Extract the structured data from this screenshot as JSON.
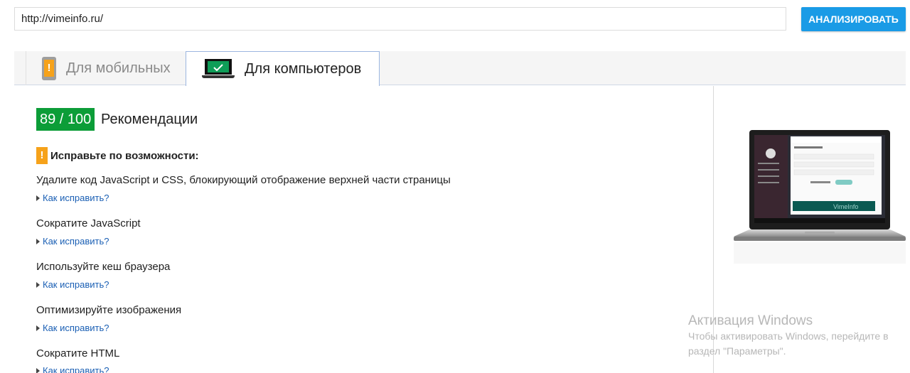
{
  "url_bar": {
    "value": "http://vimeinfo.ru/",
    "button_label": "АНАЛИЗИРОВАТЬ"
  },
  "tabs": [
    {
      "label": "Для мобильных",
      "icon": "phone-warning-icon",
      "active": false
    },
    {
      "label": "Для компьютеров",
      "icon": "laptop-check-icon",
      "active": true
    }
  ],
  "score": {
    "value": "89 / 100",
    "label": "Рекомендации",
    "color": "#0c9d38"
  },
  "section": {
    "heading": "Исправьте по возможности:",
    "icon": "warning-icon",
    "color": "#f6a21a"
  },
  "rules": [
    {
      "title": "Удалите код JavaScript и CSS, блокирующий отображение верхней части страницы",
      "link": "Как исправить?"
    },
    {
      "title": "Сократите JavaScript",
      "link": "Как исправить?"
    },
    {
      "title": "Используйте кеш браузера",
      "link": "Как исправить?"
    },
    {
      "title": "Оптимизируйте изображения",
      "link": "Как исправить?"
    },
    {
      "title": "Сократите HTML",
      "link": "Как исправить?"
    }
  ],
  "preview": {
    "site_name": "VimeInfo"
  },
  "windows_activation": {
    "title": "Активация Windows",
    "line1": "Чтобы активировать Windows, перейдите в",
    "line2": "раздел \"Параметры\"."
  },
  "accent_color": "#1a9be6"
}
